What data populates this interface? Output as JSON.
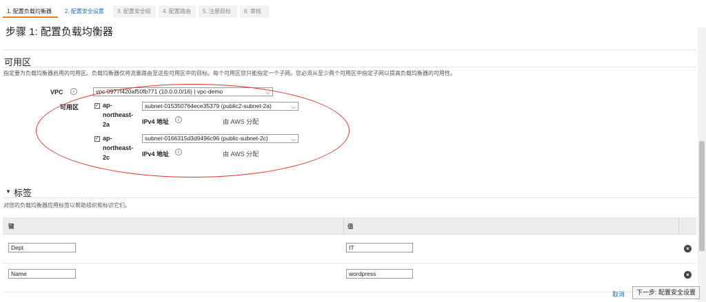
{
  "wizard": {
    "steps": [
      "1. 配置负载均衡器",
      "2. 配置安全设置",
      "3. 配置安全组",
      "4. 配置路由",
      "5. 注册目标",
      "6. 审核"
    ]
  },
  "page": {
    "title": "步骤 1: 配置负载均衡器"
  },
  "availability": {
    "title": "可用区",
    "description": "指定要为负载均衡器启用的可用区。负载均衡器仅将流量路由至这些可用区中的目标。每个可用区您只能指定一个子网。您必须从至少两个可用区中指定子网以提高负载均衡器的可用性。",
    "vpc_label": "VPC",
    "vpc_value": "vpc-0977f420af50fb771 (10.0.0.0/16) | vpc-demo",
    "az_label": "可用区",
    "zones": [
      {
        "name": "ap-northeast-2a",
        "checked": "☑",
        "subnet": "subnet-015350764ece35379 (public2-subnet-2a)",
        "ipv4_label": "IPv4 地址",
        "ipv4_value": "由 AWS 分配"
      },
      {
        "name": "ap-northeast-2c",
        "checked": "☑",
        "subnet": "subnet-0166315d3d9496c96 (public-subnet-2c)",
        "ipv4_label": "IPv4 地址",
        "ipv4_value": "由 AWS 分配"
      }
    ]
  },
  "tags": {
    "title": "标签",
    "description": "对您的负载均衡器应用标签以帮助组织和标识它们。",
    "col_key": "键",
    "col_value": "值",
    "rows": [
      {
        "key": "Dept",
        "value": "IT"
      },
      {
        "key": "Name",
        "value": "wordpress"
      }
    ]
  },
  "footer": {
    "cancel": "取消",
    "next": "下一步: 配置安全设置"
  },
  "colors": {
    "accent": "#e87c1e",
    "link": "#1f6fb8",
    "annotation": "#d9302b"
  }
}
